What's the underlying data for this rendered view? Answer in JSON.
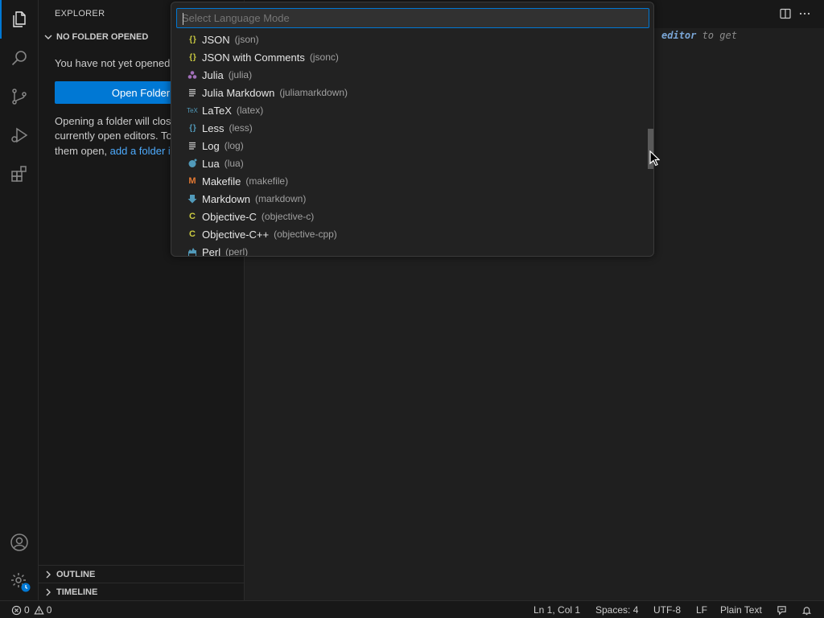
{
  "sidebar": {
    "title": "EXPLORER",
    "no_folder_header": "NO FOLDER OPENED",
    "message_line1": "You have not yet opened a folder.",
    "open_folder_button": "Open Folder",
    "desc_line1": "Opening a folder will close all",
    "desc_line2": "currently open editors. To keep",
    "desc_line3_prefix": "them open, ",
    "desc_line3_link": "add a folder instead.",
    "outline_header": "OUTLINE",
    "timeline_header": "TIMELINE"
  },
  "editor": {
    "hint_keyword": "editor",
    "hint_rest": " to get"
  },
  "quick_pick": {
    "placeholder": "Select Language Mode",
    "items": [
      {
        "label": "JSON",
        "id": "(json)",
        "icon": "braces-icon",
        "color": "#cbcb41"
      },
      {
        "label": "JSON with Comments",
        "id": "(jsonc)",
        "icon": "braces-icon",
        "color": "#cbcb41"
      },
      {
        "label": "Julia",
        "id": "(julia)",
        "icon": "julia-dots-icon",
        "color": "#a270ba"
      },
      {
        "label": "Julia Markdown",
        "id": "(juliamarkdown)",
        "icon": "lines-icon",
        "color": "#cccccc"
      },
      {
        "label": "LaTeX",
        "id": "(latex)",
        "icon": "latex-icon",
        "color": "#519aba"
      },
      {
        "label": "Less",
        "id": "(less)",
        "icon": "braces-icon",
        "color": "#519aba"
      },
      {
        "label": "Log",
        "id": "(log)",
        "icon": "lines-icon",
        "color": "#cccccc"
      },
      {
        "label": "Lua",
        "id": "(lua)",
        "icon": "lua-icon",
        "color": "#519aba"
      },
      {
        "label": "Makefile",
        "id": "(makefile)",
        "icon": "makefile-m-icon",
        "color": "#e37933"
      },
      {
        "label": "Markdown",
        "id": "(markdown)",
        "icon": "markdown-arrow-icon",
        "color": "#519aba"
      },
      {
        "label": "Objective-C",
        "id": "(objective-c)",
        "icon": "c-letter-icon",
        "color": "#cbcb41"
      },
      {
        "label": "Objective-C++",
        "id": "(objective-cpp)",
        "icon": "cpp-letter-icon",
        "color": "#cbcb41"
      },
      {
        "label": "Perl",
        "id": "(perl)",
        "icon": "camel-icon",
        "color": "#519aba"
      }
    ]
  },
  "status_bar": {
    "errors": "0",
    "warnings": "0",
    "cursor_position": "Ln 1, Col 1",
    "indentation": "Spaces: 4",
    "encoding": "UTF-8",
    "eol": "LF",
    "language": "Plain Text"
  },
  "colors": {
    "accent": "#0078d4",
    "link": "#4daafc",
    "background": "#1f1f1f",
    "sidebar_bg": "#181818"
  }
}
